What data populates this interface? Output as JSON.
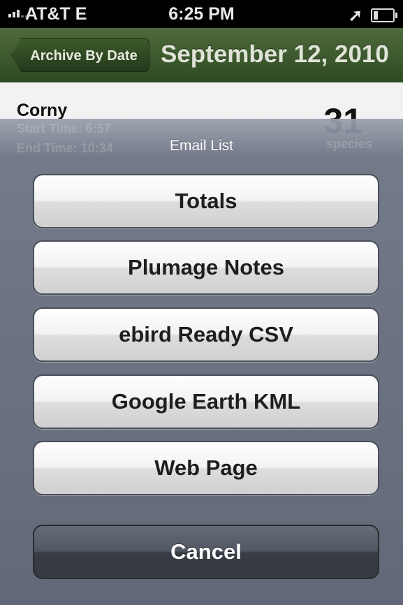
{
  "status_bar": {
    "carrier": "AT&T  E",
    "time": "6:25 PM",
    "location_icon": "location-arrow-icon",
    "battery_icon": "battery-icon"
  },
  "navbar": {
    "back_label": "Archive By Date",
    "title": "September 12, 2010",
    "accent_color": "#3b5a2a"
  },
  "background_list": {
    "session_name": "Corny",
    "species_count": "31",
    "species_label": "species",
    "start_time": "Start Time: 6:57",
    "end_time": "End Time: 10:34"
  },
  "action_sheet": {
    "title": "Email List",
    "options": [
      "Totals",
      "Plumage Notes",
      "ebird Ready CSV",
      "Google Earth KML",
      "Web Page"
    ],
    "cancel_label": "Cancel"
  }
}
